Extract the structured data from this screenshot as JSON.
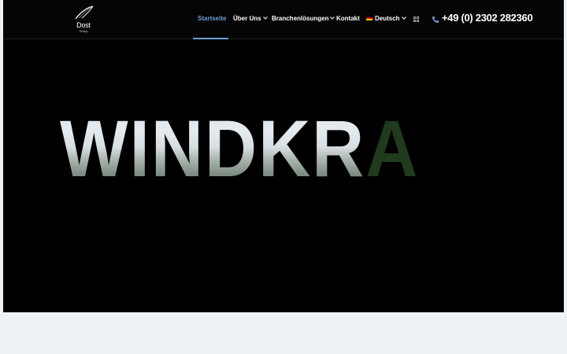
{
  "brand": {
    "name": "Dost",
    "sub": "Group"
  },
  "nav": {
    "items": [
      {
        "label": "Startseite",
        "active": true,
        "dropdown": false
      },
      {
        "label": "Über Uns",
        "active": false,
        "dropdown": true
      },
      {
        "label": "Branchenlösungen",
        "active": false,
        "dropdown": true
      },
      {
        "label": "Kontakt",
        "active": false,
        "dropdown": false
      }
    ],
    "language": {
      "label": "Deutsch",
      "icon": "german-flag-icon"
    },
    "grid_icon": "grid-icon",
    "phone": {
      "icon": "phone-icon",
      "number": "+49 (0) 2302 282360"
    }
  },
  "hero": {
    "title_main": "WINDKR",
    "title_accent": "A"
  },
  "colors": {
    "accent": "#6f9ed4",
    "nav_background": "#050505",
    "hero_background": "#000000",
    "title_accent": "#1f3a1c",
    "page_background": "#eef2f5"
  }
}
